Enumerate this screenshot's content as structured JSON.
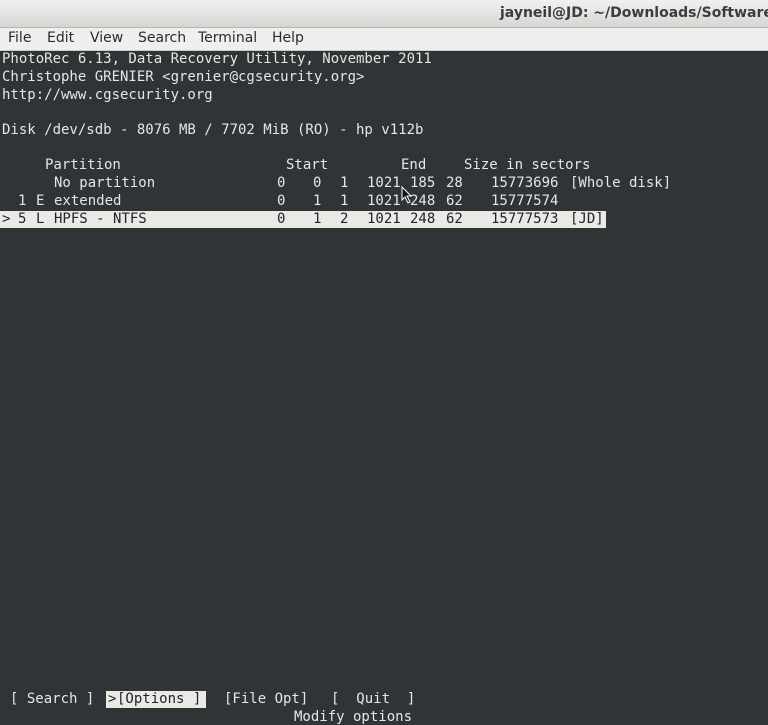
{
  "window": {
    "title": "jayneil@JD: ~/Downloads/Softwares/t"
  },
  "menu": [
    "File",
    "Edit",
    "View",
    "Search",
    "Terminal",
    "Help"
  ],
  "header": {
    "line1": "PhotoRec 6.13, Data Recovery Utility, November 2011",
    "line2": "Christophe GRENIER <grenier@cgsecurity.org>",
    "line3": "http://www.cgsecurity.org"
  },
  "disk": {
    "line": "Disk /dev/sdb - 8076 MB / 7702 MiB (RO) - hp v112b"
  },
  "table": {
    "headers": {
      "partition": "Partition",
      "start": "Start",
      "end": "End",
      "size": "Size in sectors"
    },
    "rows": [
      {
        "prefix": "",
        "num": "",
        "type": "",
        "name": "No partition",
        "start": [
          "0",
          "0",
          "1"
        ],
        "end": [
          "1021",
          "185",
          "28"
        ],
        "size": "15773696",
        "label": "[Whole disk]"
      },
      {
        "prefix": "",
        "num": "1",
        "type": "E",
        "name": "extended",
        "start": [
          "0",
          "1",
          "1"
        ],
        "end": [
          "1021",
          "248",
          "62"
        ],
        "size": "15777574",
        "label": ""
      },
      {
        "prefix": ">",
        "num": "5",
        "type": "L",
        "name": "HPFS - NTFS",
        "start": [
          "0",
          "1",
          "2"
        ],
        "end": [
          "1021",
          "248",
          "62"
        ],
        "size": "15777573",
        "label": "[JD]"
      }
    ]
  },
  "footer": {
    "search": "[ Search ]",
    "options_marker": ">",
    "options": "[Options ]",
    "file_opt": "[File Opt]",
    "quit": "[  Quit  ]",
    "hint": "Modify options"
  },
  "icons": {
    "cursor": "mouse-pointer-icon"
  },
  "colors": {
    "terminal_bg": "#2f3436",
    "text": "#e6e6e6",
    "highlight_bg": "#e9e9e5",
    "highlight_text": "#232323"
  }
}
